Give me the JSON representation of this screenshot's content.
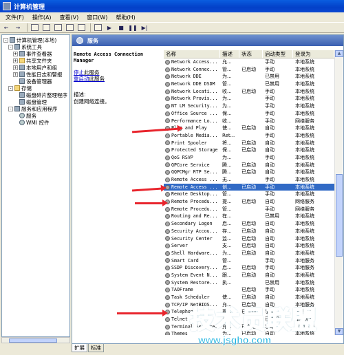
{
  "window": {
    "title": "计算机管理"
  },
  "menu": [
    "文件(F)",
    "操作(A)",
    "查看(V)",
    "窗口(W)",
    "帮助(H)"
  ],
  "toolbar": {
    "icons": [
      "back-icon",
      "forward-icon",
      "up-icon",
      "show-tree-icon",
      "properties-icon",
      "refresh-icon",
      "export-icon",
      "help-icon",
      "start-icon",
      "stop-icon",
      "pause-icon",
      "restart-icon"
    ],
    "glyphs": {
      "back": "←",
      "forward": "→",
      "start": "▶",
      "stop": "■",
      "pause": "❚❚",
      "restart": "▶|"
    }
  },
  "tree": [
    {
      "label": "计算机管理(本地)",
      "level": 0,
      "exp": "-",
      "icon": "computer"
    },
    {
      "label": "系统工具",
      "level": 1,
      "exp": "-",
      "icon": "tools"
    },
    {
      "label": "事件查看器",
      "level": 2,
      "exp": "+",
      "icon": "event"
    },
    {
      "label": "共享文件夹",
      "level": 2,
      "exp": "+",
      "icon": "folder"
    },
    {
      "label": "本地用户和组",
      "level": 2,
      "exp": "+",
      "icon": "users"
    },
    {
      "label": "性能日志和警报",
      "level": 2,
      "exp": "+",
      "icon": "perf"
    },
    {
      "label": "设备管理器",
      "level": 2,
      "exp": "",
      "icon": "device"
    },
    {
      "label": "存储",
      "level": 1,
      "exp": "-",
      "icon": "storage"
    },
    {
      "label": "磁盘碎片整理程序",
      "level": 2,
      "exp": "",
      "icon": "defrag"
    },
    {
      "label": "磁盘管理",
      "level": 2,
      "exp": "",
      "icon": "disk"
    },
    {
      "label": "服务和应用程序",
      "level": 1,
      "exp": "-",
      "icon": "apps"
    },
    {
      "label": "服务",
      "level": 2,
      "exp": "",
      "icon": "gear"
    },
    {
      "label": "WMI 控件",
      "level": 2,
      "exp": "",
      "icon": "wmi"
    }
  ],
  "pane": {
    "header": "服务",
    "selected_title": "Remote Access Connection Manager",
    "stop_link": "停止",
    "stop_suffix": "此服务",
    "restart_link": "重启动",
    "restart_suffix": "此服务",
    "desc_label": "描述:",
    "desc_text": "创建网络连接。"
  },
  "columns": {
    "name": "名称",
    "desc": "描述",
    "status": "状态",
    "startup": "启动类型",
    "logon": "登录为"
  },
  "services": [
    {
      "name": "Network Access...",
      "desc": "允...",
      "status": "",
      "startup": "手动",
      "logon": "本地系统"
    },
    {
      "name": "Network Connec...",
      "desc": "管...",
      "status": "已启动",
      "startup": "手动",
      "logon": "本地系统"
    },
    {
      "name": "Network DDE",
      "desc": "为...",
      "status": "",
      "startup": "已禁用",
      "logon": "本地系统"
    },
    {
      "name": "Network DDE DSDM",
      "desc": "管...",
      "status": "",
      "startup": "已禁用",
      "logon": "本地系统"
    },
    {
      "name": "Network Locati...",
      "desc": "收...",
      "status": "已启动",
      "startup": "手动",
      "logon": "本地系统"
    },
    {
      "name": "Network Provis...",
      "desc": "为...",
      "status": "",
      "startup": "手动",
      "logon": "本地系统"
    },
    {
      "name": "NT LM Security...",
      "desc": "为...",
      "status": "",
      "startup": "手动",
      "logon": "本地系统"
    },
    {
      "name": "Office Source ...",
      "desc": "保...",
      "status": "",
      "startup": "手动",
      "logon": "本地系统"
    },
    {
      "name": "Performance Lo...",
      "desc": "收...",
      "status": "",
      "startup": "手动",
      "logon": "网络服务"
    },
    {
      "name": "Plug and Play",
      "desc": "使...",
      "status": "已启动",
      "startup": "自动",
      "logon": "本地系统"
    },
    {
      "name": "Portable Media...",
      "desc": "Ret...",
      "status": "",
      "startup": "手动",
      "logon": "本地系统"
    },
    {
      "name": "Print Spooler",
      "desc": "将...",
      "status": "已启动",
      "startup": "自动",
      "logon": "本地系统"
    },
    {
      "name": "Protected Storage",
      "desc": "保...",
      "status": "已启动",
      "startup": "自动",
      "logon": "本地系统"
    },
    {
      "name": "QoS RSVP",
      "desc": "为...",
      "status": "",
      "startup": "手动",
      "logon": "本地系统"
    },
    {
      "name": "QPCore Service",
      "desc": "腾...",
      "status": "已启动",
      "startup": "自动",
      "logon": "本地系统"
    },
    {
      "name": "QQPCMgr RTP Se...",
      "desc": "腾...",
      "status": "已启动",
      "startup": "自动",
      "logon": "本地系统"
    },
    {
      "name": "Remote Access ...",
      "desc": "无...",
      "status": "",
      "startup": "手动",
      "logon": "本地系统"
    },
    {
      "name": "Remote Access ...",
      "desc": "创...",
      "status": "已启动",
      "startup": "手动",
      "logon": "本地系统",
      "selected": true
    },
    {
      "name": "Remote Desktop...",
      "desc": "管...",
      "status": "",
      "startup": "手动",
      "logon": "本地系统"
    },
    {
      "name": "Remote Procedu...",
      "desc": "提...",
      "status": "已启动",
      "startup": "自动",
      "logon": "网络服务"
    },
    {
      "name": "Remote Procedu...",
      "desc": "管...",
      "status": "",
      "startup": "手动",
      "logon": "网络服务"
    },
    {
      "name": "Routing and Re...",
      "desc": "在...",
      "status": "",
      "startup": "已禁用",
      "logon": "本地系统"
    },
    {
      "name": "Secondary Logon",
      "desc": "启...",
      "status": "已启动",
      "startup": "自动",
      "logon": "本地系统"
    },
    {
      "name": "Security Accou...",
      "desc": "存...",
      "status": "已启动",
      "startup": "自动",
      "logon": "本地系统"
    },
    {
      "name": "Security Center",
      "desc": "监...",
      "status": "已启动",
      "startup": "自动",
      "logon": "本地系统"
    },
    {
      "name": "Server",
      "desc": "支...",
      "status": "已启动",
      "startup": "自动",
      "logon": "本地系统"
    },
    {
      "name": "Shell Hardware...",
      "desc": "为...",
      "status": "已启动",
      "startup": "自动",
      "logon": "本地系统"
    },
    {
      "name": "Smart Card",
      "desc": "管...",
      "status": "",
      "startup": "手动",
      "logon": "本地服务"
    },
    {
      "name": "SSDP Discovery...",
      "desc": "启...",
      "status": "已启动",
      "startup": "手动",
      "logon": "本地服务"
    },
    {
      "name": "System Event N...",
      "desc": "跟...",
      "status": "已启动",
      "startup": "自动",
      "logon": "本地系统"
    },
    {
      "name": "System Restore...",
      "desc": "执...",
      "status": "",
      "startup": "已禁用",
      "logon": "本地系统"
    },
    {
      "name": "TAOFrame",
      "desc": "",
      "status": "已启动",
      "startup": "手动",
      "logon": "本地系统"
    },
    {
      "name": "Task Scheduler",
      "desc": "使...",
      "status": "已启动",
      "startup": "自动",
      "logon": "本地系统"
    },
    {
      "name": "TCP/IP NetBIOS...",
      "desc": "允...",
      "status": "已启动",
      "startup": "自动",
      "logon": "本地服务"
    },
    {
      "name": "Telephony",
      "desc": "提...",
      "status": "已启动",
      "startup": "手动",
      "logon": "本地系统"
    },
    {
      "name": "Telnet",
      "desc": "允...",
      "status": "",
      "startup": "已禁用",
      "logon": "本地系统"
    },
    {
      "name": "Terminal Services",
      "desc": "允...",
      "status": "已启动",
      "startup": "手动",
      "logon": "本地系统"
    },
    {
      "name": "Themes",
      "desc": "为...",
      "status": "已启动",
      "startup": "自动",
      "logon": "本地系统"
    }
  ],
  "tabs": [
    "扩展",
    "标准"
  ],
  "watermark": {
    "main": "技术员联盟",
    "url": "www.jsgho.com"
  },
  "colors": {
    "selection": "#316ac5",
    "arrow": "#e8252d",
    "titlebar": "#0a5ddf",
    "watermark": "#17b2e0"
  }
}
